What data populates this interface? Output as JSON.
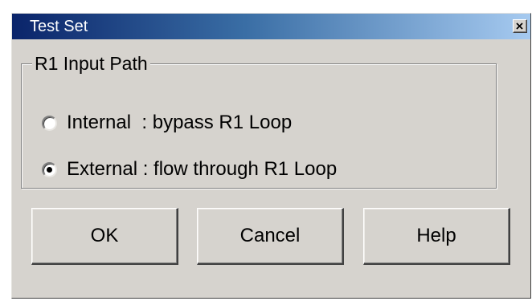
{
  "window": {
    "title": "Test Set"
  },
  "group": {
    "label": "R1 Input Path",
    "options": [
      {
        "label": "Internal  : bypass R1 Loop",
        "selected": false
      },
      {
        "label": "External : flow through R1 Loop",
        "selected": true
      }
    ]
  },
  "buttons": {
    "ok": "OK",
    "cancel": "Cancel",
    "help": "Help"
  },
  "colors": {
    "titlebar_start": "#0a246a",
    "titlebar_end": "#a6caf0",
    "face": "#d6d3ce"
  },
  "icons": {
    "close": "close-icon",
    "radio_on": "radio-selected",
    "radio_off": "radio-unselected"
  }
}
